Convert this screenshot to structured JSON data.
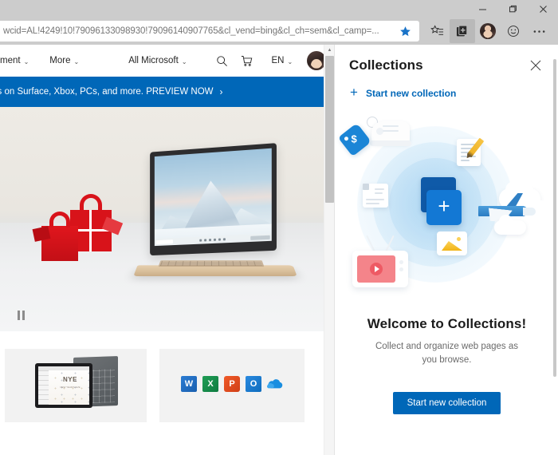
{
  "window": {
    "minimize_label": "Minimize",
    "restore_label": "Restore",
    "close_label": "Close"
  },
  "address_bar": {
    "url": "wcid=AL!4249!10!79096133098930!79096140907765&cl_vend=bing&cl_ch=sem&cl_camp=...",
    "favorite_icon": "star-filled-icon",
    "favorite_color": "#1a73c8"
  },
  "toolbar": {
    "favorites_icon": "favorites-list-icon",
    "collections_icon": "collections-icon",
    "profile_icon": "profile-avatar-icon",
    "feedback_icon": "smiley-feedback-icon",
    "settings_icon": "ellipsis-more-icon",
    "collections_active": true
  },
  "webpage": {
    "nav": [
      {
        "label": "ment",
        "chevron": "⌄"
      },
      {
        "label": "More",
        "chevron": "⌄"
      },
      {
        "label": "All Microsoft",
        "chevron": "⌄"
      }
    ],
    "search_icon": "search-icon",
    "cart_icon": "shopping-cart-icon",
    "language": "EN",
    "language_chevron": "⌄",
    "account_icon": "account-avatar-icon",
    "banner": {
      "text": "ls on Surface, Xbox, PCs, and more. PREVIEW NOW",
      "arrow": "›",
      "background": "#0067b8"
    },
    "hero": {
      "pause_label": "Pause",
      "alt": "Surface Laptop with red Microsoft gift bags"
    },
    "cards": [
      {
        "name": "surface-go-card",
        "alt": "Surface Go tablet with keyboard",
        "screen_text": "NYE",
        "screen_subtext": "NEW YEAR'S EVE"
      },
      {
        "name": "office-apps-card",
        "apps": [
          "W",
          "X",
          "P",
          "O",
          "OneDrive"
        ]
      }
    ]
  },
  "collections": {
    "title": "Collections",
    "close_icon": "close-icon",
    "start_new_label": "Start new collection",
    "plus_icon": "plus-icon",
    "accent_color": "#0067b8",
    "welcome": {
      "heading": "Welcome to Collections!",
      "description": "Collect and organize web pages as you browse.",
      "button_label": "Start new collection"
    },
    "illustration": {
      "items": [
        "price-tag-icon",
        "shoe-icon",
        "document-pencil-icon",
        "article-icon",
        "collection-cards-plus-icon",
        "airplane-cloud-icon",
        "photo-icon",
        "tv-video-icon"
      ]
    }
  }
}
